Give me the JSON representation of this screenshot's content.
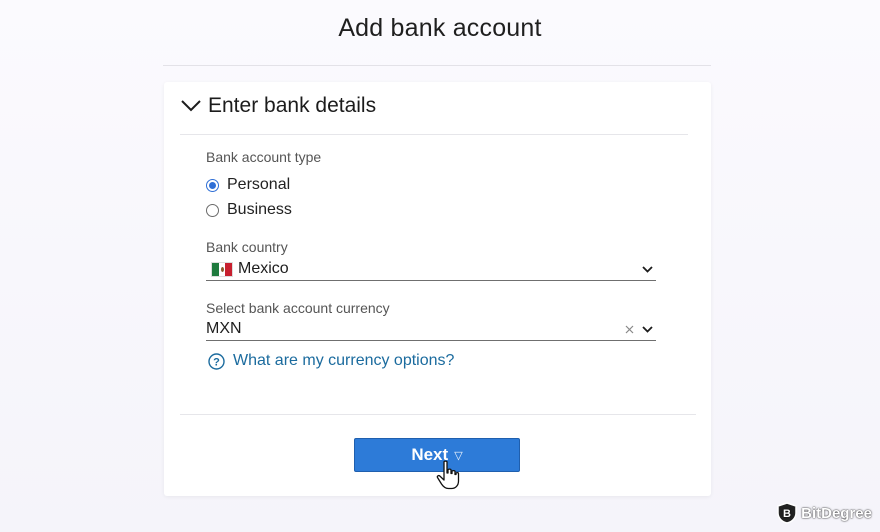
{
  "page": {
    "title": "Add bank account"
  },
  "section": {
    "title": "Enter bank details",
    "expanded": true,
    "icon": "chevron-down-icon"
  },
  "account_type": {
    "label": "Bank account type",
    "options": [
      {
        "label": "Personal",
        "selected": true
      },
      {
        "label": "Business",
        "selected": false
      }
    ]
  },
  "country": {
    "label": "Bank country",
    "value": "Mexico",
    "flag_icon": "mexico-flag-icon"
  },
  "currency": {
    "label": "Select bank account currency",
    "value": "MXN"
  },
  "help": {
    "link_text": "What are my currency options?"
  },
  "actions": {
    "next_label": "Next",
    "next_caret": "▽"
  },
  "watermark": {
    "text": "BitDegree"
  },
  "colors": {
    "primary_button": "#2d7bd8",
    "link": "#1b6b9e",
    "radio_selected": "#2f6fd6"
  }
}
